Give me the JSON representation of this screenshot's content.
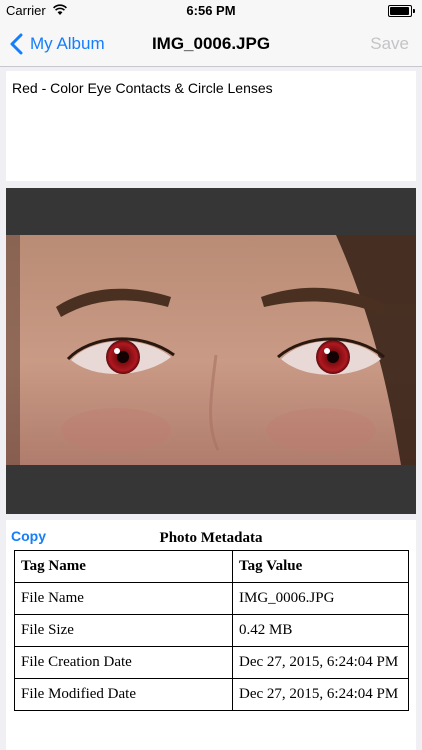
{
  "status_bar": {
    "carrier": "Carrier",
    "time": "6:56 PM"
  },
  "nav": {
    "back_label": "My Album",
    "title": "IMG_0006.JPG",
    "save_label": "Save",
    "accent_color": "#147efb",
    "disabled_color": "#c4c4c8"
  },
  "caption": "Red - Color Eye Contacts & Circle Lenses",
  "metadata": {
    "copy_label": "Copy",
    "title": "Photo Metadata",
    "headers": [
      "Tag Name",
      "Tag Value"
    ],
    "rows": [
      [
        "File Name",
        "IMG_0006.JPG"
      ],
      [
        "File Size",
        "0.42 MB"
      ],
      [
        "File Creation Date",
        "Dec 27, 2015, 6:24:04 PM"
      ],
      [
        "File Modified Date",
        "Dec 27, 2015, 6:24:04 PM"
      ]
    ]
  },
  "icons": {
    "back": "chevron-left-icon",
    "wifi": "wifi-icon",
    "battery": "battery-icon"
  }
}
